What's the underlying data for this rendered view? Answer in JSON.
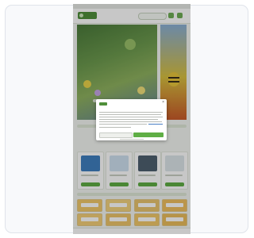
{
  "frame": {
    "background": "#f8f9fb",
    "border": "#dfe3ea"
  },
  "site": {
    "brand_color": "#4f8f3a",
    "accent_color": "#5fae45",
    "header": {
      "logo": "logo",
      "icons": [
        "search-icon",
        "user-icon",
        "cart-icon"
      ]
    },
    "hero": {
      "image": "flower-meadow-with-bee"
    },
    "products": [
      {
        "image": "product-card-blue"
      },
      {
        "image": "product-card-light"
      },
      {
        "image": "product-card-dark"
      },
      {
        "image": "product-card-white"
      }
    ],
    "label_tiles": [
      {
        "color": "#f1c86a"
      },
      {
        "color": "#f3d27e"
      },
      {
        "color": "#e9c46d"
      },
      {
        "color": "#f0bf5f"
      },
      {
        "color": "#f4cf78"
      },
      {
        "color": "#eec46a"
      },
      {
        "color": "#f1c86a"
      },
      {
        "color": "#ebbd5c"
      }
    ]
  },
  "cookie_dialog": {
    "title": "",
    "settings_label": "",
    "accept_label": "",
    "close_icon": "close-icon"
  }
}
